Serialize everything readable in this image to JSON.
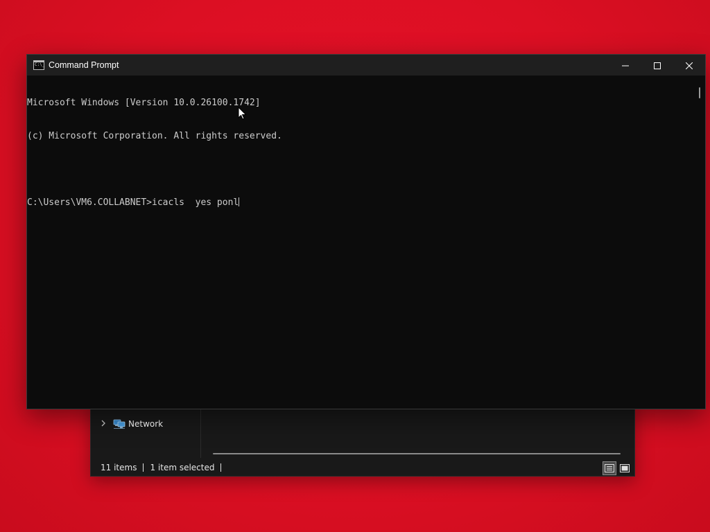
{
  "explorer": {
    "nav_items": [
      {
        "label": "Network",
        "icon": "network-icon",
        "expand_icon": "chevron-right-icon"
      }
    ],
    "status": {
      "item_count": "11 items",
      "selection": "1 item selected"
    },
    "view_buttons": [
      {
        "name": "details-view-icon",
        "active": true
      },
      {
        "name": "large-icons-view-icon",
        "active": false
      }
    ]
  },
  "cmd": {
    "title": "Command Prompt",
    "app_icon_text": "C:\\_",
    "lines": [
      "Microsoft Windows [Version 10.0.26100.1742]",
      "(c) Microsoft Corporation. All rights reserved.",
      "",
      "C:\\Users\\VM6.COLLABNET>icacls  yes ponl"
    ],
    "caption_buttons": [
      "minimize-icon",
      "maximize-icon",
      "close-icon"
    ]
  },
  "colors": {
    "desktop_background": "#e8112a",
    "console_background": "#0c0c0c",
    "console_text": "#cccccc",
    "titlebar": "#1f1f1f",
    "explorer_background": "#191919"
  }
}
